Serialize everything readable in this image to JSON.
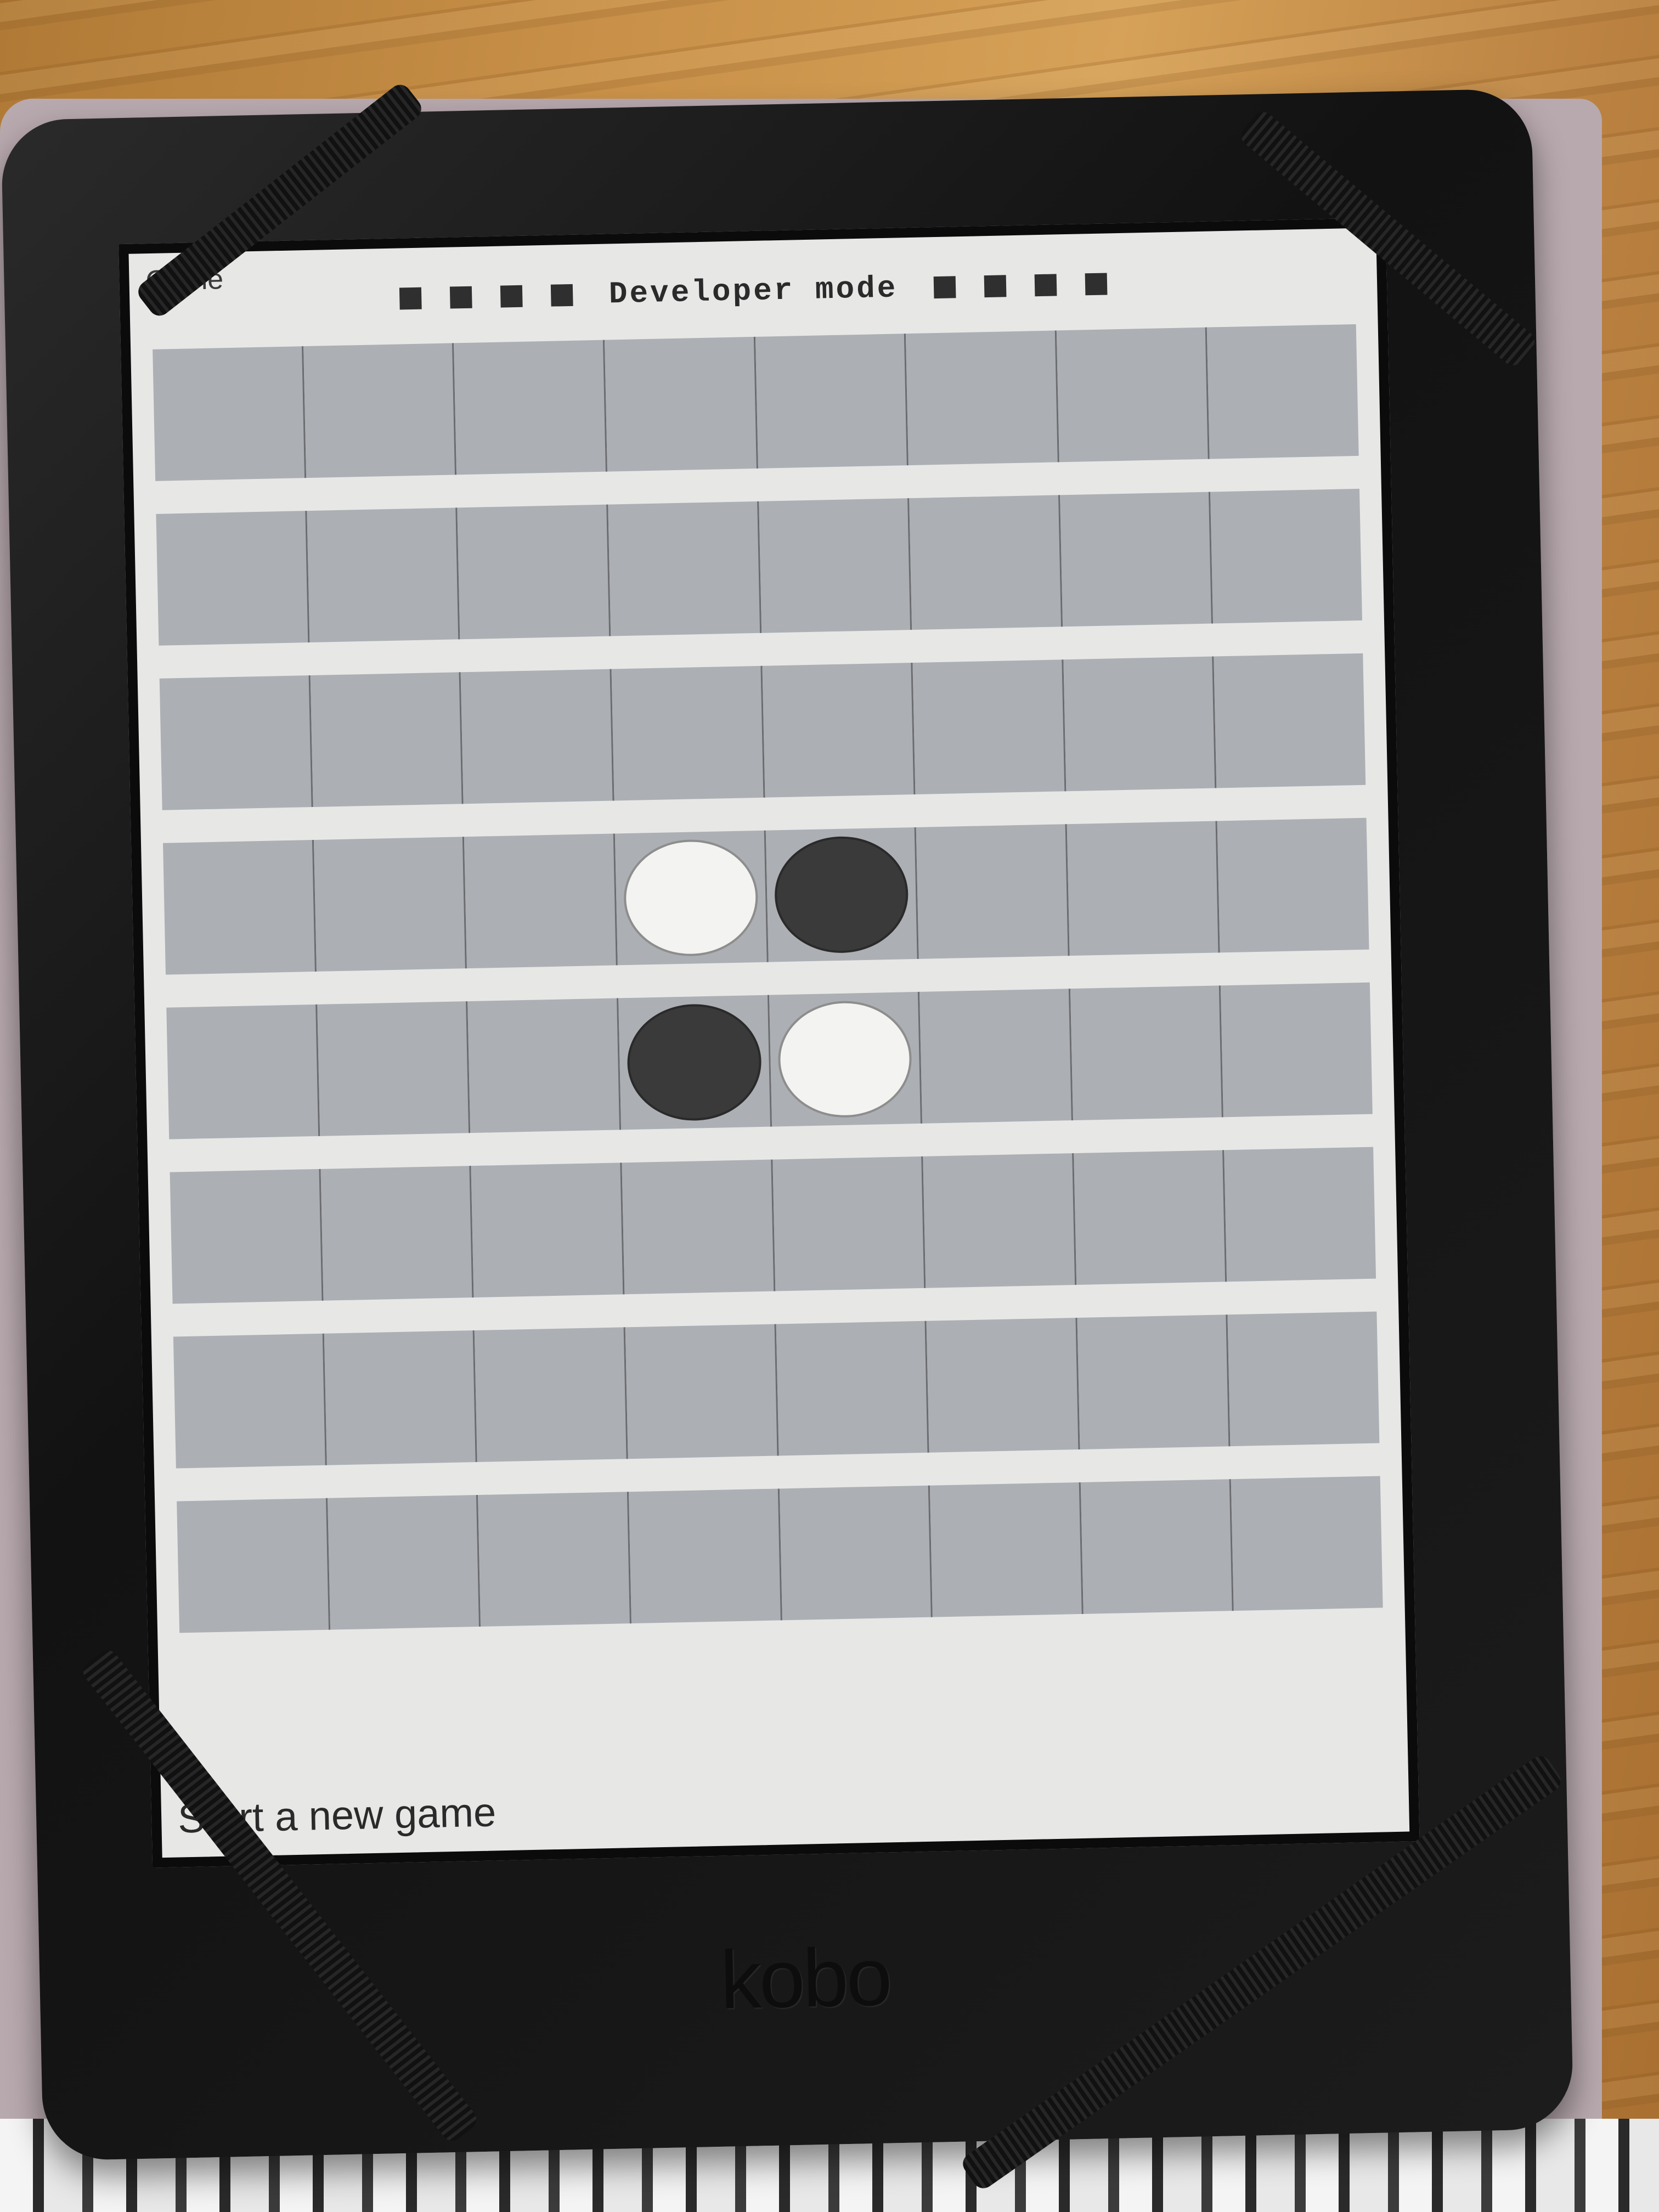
{
  "screen": {
    "app_title": "Game",
    "banner_text": "Developer mode",
    "status_text": "Start a new game"
  },
  "board": {
    "rows": 8,
    "cols": 8,
    "pieces": [
      {
        "row": 3,
        "col": 3,
        "color": "white"
      },
      {
        "row": 3,
        "col": 4,
        "color": "black"
      },
      {
        "row": 4,
        "col": 3,
        "color": "black"
      },
      {
        "row": 4,
        "col": 4,
        "color": "white"
      }
    ]
  },
  "device": {
    "brand": "kobo"
  }
}
